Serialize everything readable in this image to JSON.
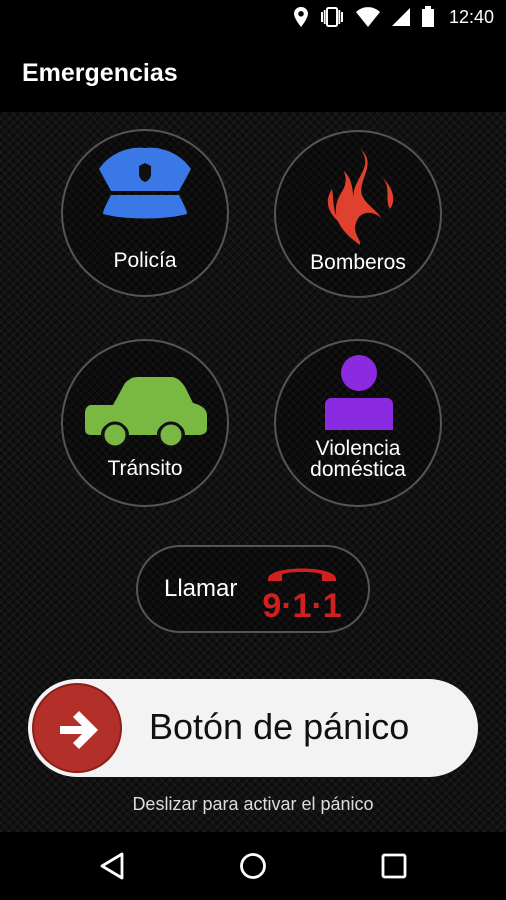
{
  "status_bar": {
    "time": "12:40",
    "icons": [
      "location-icon",
      "vibrate-icon",
      "wifi-icon",
      "signal-icon",
      "battery-icon"
    ]
  },
  "app_bar": {
    "title": "Emergencias"
  },
  "services": [
    {
      "label": "Policía",
      "icon": "police-hat-icon",
      "color": "#3b78e7"
    },
    {
      "label": "Bomberos",
      "icon": "fire-icon",
      "color": "#e0412e"
    },
    {
      "label": "Tránsito",
      "icon": "car-icon",
      "color": "#78b843"
    },
    {
      "label_line1": "Violencia",
      "label_line2": "doméstica",
      "icon": "person-icon",
      "color": "#8a2be2"
    }
  ],
  "call": {
    "label": "Llamar",
    "number": "9·1·1",
    "icon": "phone-icon",
    "color": "#d21f1f"
  },
  "panic": {
    "label": "Botón de pánico",
    "knob_color": "#b32f2a",
    "hint": "Deslizar para activar el pánico"
  },
  "nav": {
    "icons": [
      "back-icon",
      "home-icon",
      "recents-icon"
    ]
  }
}
